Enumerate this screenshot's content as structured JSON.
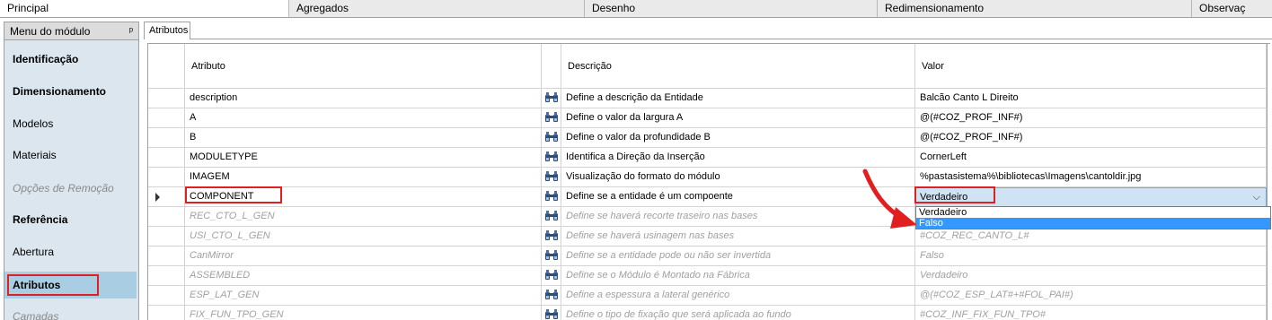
{
  "top_tabs": [
    {
      "label": "Principal",
      "active": true
    },
    {
      "label": "Agregados",
      "active": false
    },
    {
      "label": "Desenho",
      "active": false
    },
    {
      "label": "Redimensionamento",
      "active": false
    },
    {
      "label": "Observaç",
      "active": false
    }
  ],
  "module_menu": {
    "title": "Menu do módulo",
    "pin_icon": "pin-icon",
    "items": [
      {
        "label": "Identificação",
        "style": "bold"
      },
      {
        "label": "Dimensionamento",
        "style": "bold"
      },
      {
        "label": "Modelos",
        "style": "normal"
      },
      {
        "label": "Materiais",
        "style": "normal"
      },
      {
        "label": "Opções de Remoção",
        "style": "disabled"
      },
      {
        "label": "Referência",
        "style": "bold"
      },
      {
        "label": "Abertura",
        "style": "normal"
      },
      {
        "label": "Atributos",
        "style": "bold",
        "selected": true
      },
      {
        "label": "Camadas",
        "style": "disabled"
      }
    ]
  },
  "subtab": {
    "label": "Atributos"
  },
  "grid": {
    "headers": {
      "attribute": "Atributo",
      "description": "Descrição",
      "value": "Valor"
    },
    "rows": [
      {
        "attribute": "description",
        "description": "Define a descrição da Entidade",
        "value": "Balcão Canto L Direito",
        "disabled": false
      },
      {
        "attribute": "A",
        "description": "Define o valor da largura A",
        "value": "@(#COZ_PROF_INF#)",
        "disabled": false
      },
      {
        "attribute": "B",
        "description": "Define o valor da profundidade B",
        "value": "@(#COZ_PROF_INF#)",
        "disabled": false
      },
      {
        "attribute": "MODULETYPE",
        "description": "Identifica a Direção da Inserção",
        "value": "CornerLeft",
        "disabled": false
      },
      {
        "attribute": "IMAGEM",
        "description": "Visualização do formato do módulo",
        "value": "%pastasistema%\\bibliotecas\\Imagens\\cantoldir.jpg",
        "disabled": false
      },
      {
        "attribute": "COMPONENT",
        "description": "Define se a entidade é um compoente",
        "value": "Verdadeiro",
        "disabled": false,
        "current": true
      },
      {
        "attribute": "REC_CTO_L_GEN",
        "description": "Define se haverá recorte traseiro nas bases",
        "value": "",
        "disabled": true
      },
      {
        "attribute": "USI_CTO_L_GEN",
        "description": "Define se haverá usinagem nas bases",
        "value": "#COZ_REC_CANTO_L#",
        "disabled": true
      },
      {
        "attribute": "CanMirror",
        "description": "Define se a entidade pode ou não ser invertida",
        "value": "Falso",
        "disabled": true
      },
      {
        "attribute": "ASSEMBLED",
        "description": "Define se o Módulo é Montado na Fábrica",
        "value": "Verdadeiro",
        "disabled": true
      },
      {
        "attribute": "ESP_LAT_GEN",
        "description": "Define a espessura a lateral genérico",
        "value": "@(#COZ_ESP_LAT#+#FOL_PAI#)",
        "disabled": true
      },
      {
        "attribute": "FIX_FUN_TPO_GEN",
        "description": "Define o tipo de fixação que será aplicada ao fundo",
        "value": "#COZ_INF_FIX_FUN_TPO#",
        "disabled": true
      }
    ]
  },
  "dropdown": {
    "options": [
      "Verdadeiro",
      "Falso"
    ],
    "highlighted": "Falso",
    "chevron_icon": "chevron-down-icon"
  },
  "annotation_color": "#e02020",
  "selection_color": "#3399ff"
}
